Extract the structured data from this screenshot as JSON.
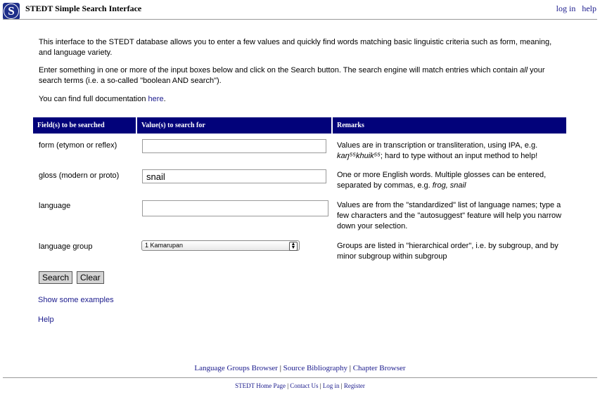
{
  "header": {
    "title": "STEDT Simple Search Interface",
    "links": [
      "log in",
      "help"
    ]
  },
  "intro": {
    "p1": "This interface to the STEDT database allows you to enter a few values and quickly find words matching basic linguistic criteria such as form, meaning, and language variety.",
    "p2_pre": "Enter something in one or more of the input boxes below and click on the Search button. The search engine will match entries which contain ",
    "p2_em": "all",
    "p2_post": " your search terms (i.e. a so-called \"boolean AND search\").",
    "p3_pre": "You can find full documentation ",
    "p3_link": "here",
    "p3_post": "."
  },
  "table": {
    "headers": [
      "Field(s) to be searched",
      "Value(s) to search for",
      "Remarks"
    ],
    "rows": [
      {
        "label": "form (etymon or reflex)",
        "value": "",
        "remark_pre": "Values are in transcription or transliteration, using IPA, e.g. ",
        "remark_em": "kaŋ⁵⁵khuik⁵⁵",
        "remark_post": "; hard to type without an input method to help!"
      },
      {
        "label": "gloss (modern or proto)",
        "value": "snail",
        "remark_pre": "One or more English words. Multiple glosses can be entered, separated by commas, e.g. ",
        "remark_em": "frog, snail",
        "remark_post": ""
      },
      {
        "label": "language",
        "value": "",
        "remark": "Values are from the \"standardized\" list of language names; type a few characters and the \"autosuggest\" feature will help you narrow down your selection."
      },
      {
        "label": "language group",
        "value": "1 Kamarupan",
        "remark": "Groups are listed in \"hierarchical order\", i.e. by subgroup, and by minor subgroup within subgroup"
      }
    ]
  },
  "buttons": {
    "search": "Search",
    "clear": "Clear"
  },
  "links": {
    "examples": "Show some examples",
    "help": "Help"
  },
  "footer": {
    "primary": [
      "Language Groups Browser",
      "Source Bibliography",
      "Chapter Browser"
    ],
    "secondary": [
      "STEDT Home Page",
      "Contact Us",
      "Log in",
      "Register"
    ]
  }
}
